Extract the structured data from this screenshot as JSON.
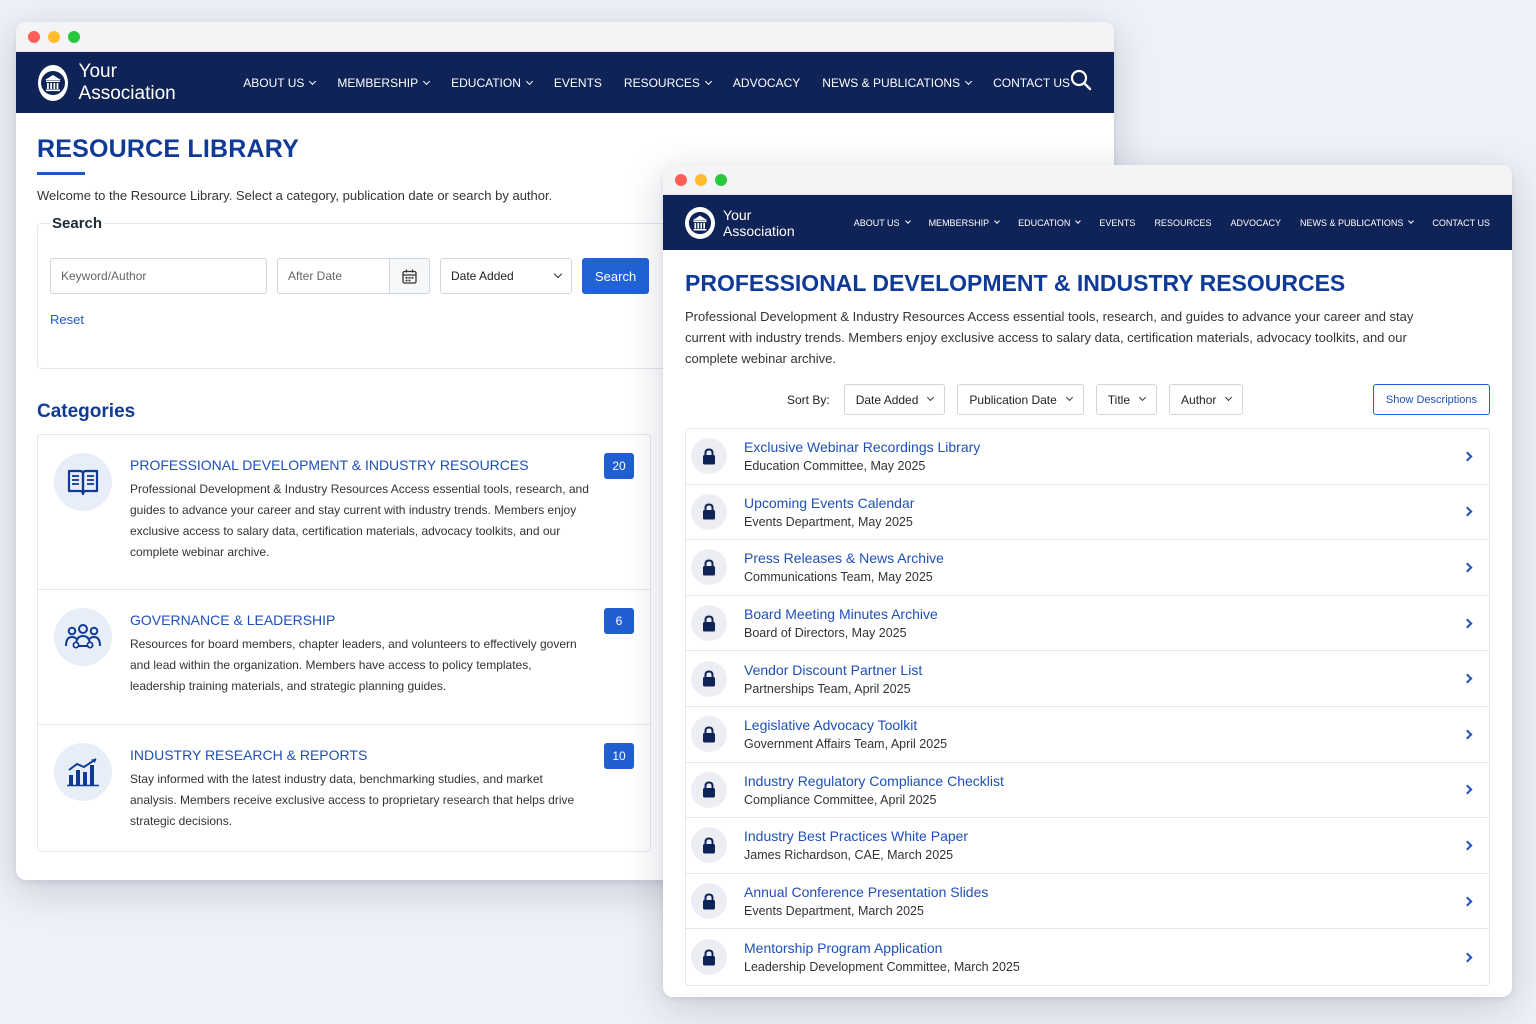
{
  "brand": {
    "name": "Your Association",
    "primary_color": "#0f2357",
    "accent_color": "#1f63d6",
    "logo_icon": "columns-building-icon"
  },
  "nav": [
    {
      "label": "ABOUT US",
      "dropdown": true
    },
    {
      "label": "MEMBERSHIP",
      "dropdown": true
    },
    {
      "label": "EDUCATION",
      "dropdown": true
    },
    {
      "label": "EVENTS",
      "dropdown": false
    },
    {
      "label": "RESOURCES",
      "dropdown": true
    },
    {
      "label": "ADVOCACY",
      "dropdown": false
    },
    {
      "label": "NEWS & PUBLICATIONS",
      "dropdown": true
    },
    {
      "label": "CONTACT US",
      "dropdown": false
    }
  ],
  "nav_small": [
    {
      "label": "ABOUT US",
      "dropdown": true
    },
    {
      "label": "MEMBERSHIP",
      "dropdown": true
    },
    {
      "label": "EDUCATION",
      "dropdown": true
    },
    {
      "label": "EVENTS",
      "dropdown": false
    },
    {
      "label": "RESOURCES",
      "dropdown": false
    },
    {
      "label": "ADVOCACY",
      "dropdown": false
    },
    {
      "label": "NEWS & PUBLICATIONS",
      "dropdown": true
    },
    {
      "label": "CONTACT US",
      "dropdown": false
    }
  ],
  "library": {
    "title": "RESOURCE LIBRARY",
    "intro": "Welcome to the Resource Library. Select a category, publication date or search by author.",
    "search": {
      "legend": "Search",
      "keyword_placeholder": "Keyword/Author",
      "date_placeholder": "After Date",
      "sort_value": "Date Added",
      "button": "Search",
      "reset": "Reset"
    },
    "categories_title": "Categories",
    "categories": [
      {
        "name": "PROFESSIONAL DEVELOPMENT & INDUSTRY RESOURCES",
        "count": "20",
        "icon": "open-book-icon",
        "desc": "Professional Development & Industry Resources Access essential tools, research, and guides to advance your career and stay current with industry trends. Members enjoy exclusive access to salary data, certification materials, advocacy toolkits, and our complete webinar archive."
      },
      {
        "name": "GOVERNANCE & LEADERSHIP",
        "count": "6",
        "icon": "people-group-icon",
        "desc": "Resources for board members, chapter leaders, and volunteers to effectively govern and lead within the organization. Members have access to policy templates, leadership training materials, and strategic planning guides."
      },
      {
        "name": "INDUSTRY RESEARCH & REPORTS",
        "count": "10",
        "icon": "bar-chart-icon",
        "desc": "Stay informed with the latest industry data, benchmarking studies, and market analysis. Members receive exclusive access to proprietary research that helps drive strategic decisions."
      }
    ]
  },
  "category_page": {
    "title": "PROFESSIONAL DEVELOPMENT & INDUSTRY RESOURCES",
    "desc": "Professional Development & Industry Resources Access essential tools, research, and guides to advance your career and stay current with industry trends. Members enjoy exclusive access to salary data, certification materials, advocacy toolkits, and our complete webinar archive.",
    "sort_label": "Sort By:",
    "sort_options": [
      "Date Added",
      "Publication Date",
      "Title",
      "Author"
    ],
    "show_descriptions": "Show Descriptions",
    "resources": [
      {
        "title": "Exclusive Webinar Recordings Library",
        "meta": "Education Committee, May 2025"
      },
      {
        "title": "Upcoming Events Calendar",
        "meta": "Events Department, May 2025"
      },
      {
        "title": "Press Releases & News Archive",
        "meta": "Communications Team, May 2025"
      },
      {
        "title": "Board Meeting Minutes Archive",
        "meta": "Board of Directors, May 2025"
      },
      {
        "title": "Vendor Discount Partner List",
        "meta": "Partnerships Team, April 2025"
      },
      {
        "title": "Legislative Advocacy Toolkit",
        "meta": "Government Affairs Team, April 2025"
      },
      {
        "title": "Industry Regulatory Compliance Checklist",
        "meta": "Compliance Committee, April 2025"
      },
      {
        "title": "Industry Best Practices White Paper",
        "meta": "James Richardson, CAE, March 2025"
      },
      {
        "title": "Annual Conference Presentation Slides",
        "meta": "Events Department, March 2025"
      },
      {
        "title": "Mentorship Program Application",
        "meta": "Leadership Development Committee, March 2025"
      }
    ]
  }
}
